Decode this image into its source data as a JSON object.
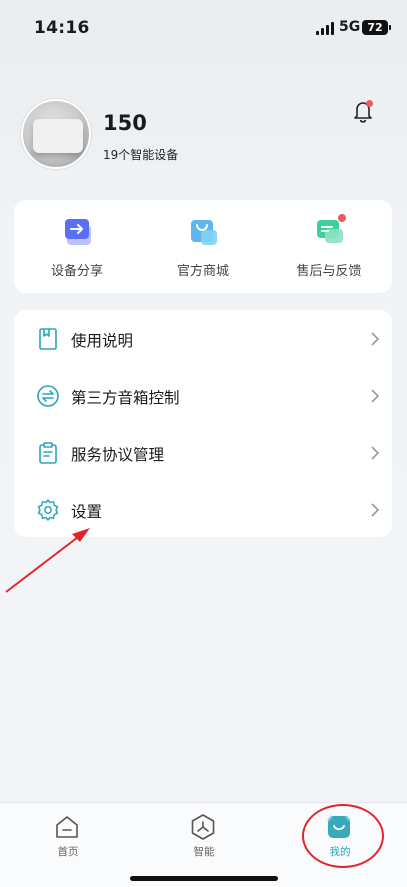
{
  "status_bar": {
    "time": "14:16",
    "network": "5G",
    "battery": "72"
  },
  "profile": {
    "name": "150",
    "device_count": "19个智能设备"
  },
  "shortcuts": [
    {
      "label": "设备分享",
      "icon": "share-device-icon"
    },
    {
      "label": "官方商城",
      "icon": "shopping-bag-icon"
    },
    {
      "label": "售后与反馈",
      "icon": "feedback-chat-icon"
    }
  ],
  "menu": [
    {
      "label": "使用说明",
      "icon": "manual-book-icon"
    },
    {
      "label": "第三方音箱控制",
      "icon": "transfer-arrows-icon"
    },
    {
      "label": "服务协议管理",
      "icon": "clipboard-icon"
    },
    {
      "label": "设置",
      "icon": "gear-icon"
    }
  ],
  "tabs": [
    {
      "label": "首页",
      "icon": "home-icon"
    },
    {
      "label": "智能",
      "icon": "smart-hexagon-icon"
    },
    {
      "label": "我的",
      "icon": "my-profile-icon"
    }
  ],
  "colors": {
    "accent": "#2aa6b8",
    "annotation": "#e2252b",
    "notification": "#f05a5a"
  }
}
